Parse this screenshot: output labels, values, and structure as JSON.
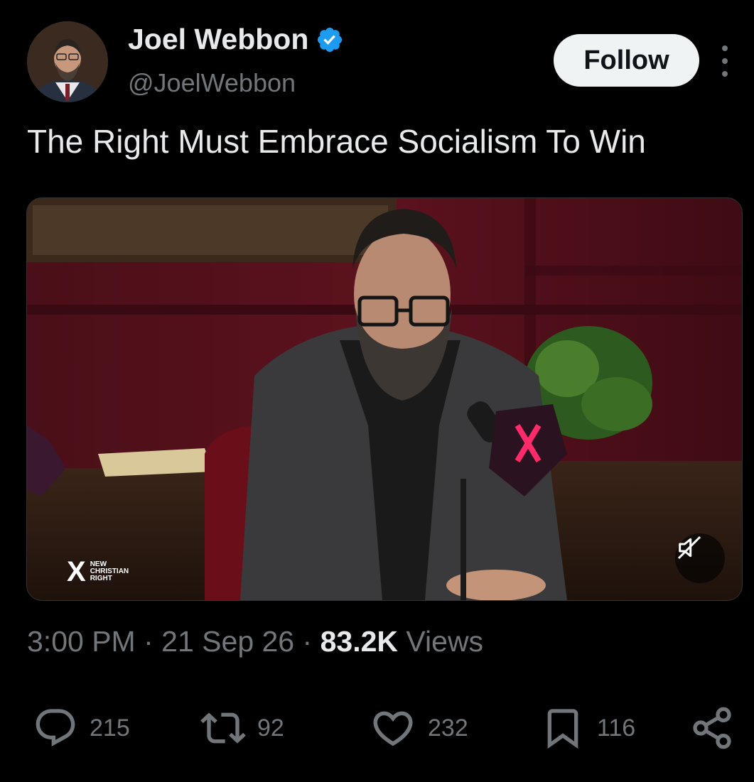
{
  "author": {
    "display_name": "Joel Webbon",
    "handle": "@JoelWebbon",
    "verified": true,
    "avatar_icon": "profile-photo"
  },
  "follow_button": {
    "label": "Follow"
  },
  "tweet": {
    "text": "The Right Must Embrace Socialism To Win"
  },
  "media": {
    "watermark_lines": [
      "NEW",
      "CHRISTIAN",
      "RIGHT"
    ],
    "mute_icon": "speaker-muted-icon"
  },
  "meta": {
    "time": "3:00 PM",
    "separator": "·",
    "date": "21 Sep 26",
    "views_count": "83.2K",
    "views_label": "Views"
  },
  "actions": {
    "replies": "215",
    "reposts": "92",
    "likes": "232",
    "bookmarks": "116"
  },
  "colors": {
    "background": "#000000",
    "text_primary": "#e7e9ea",
    "text_secondary": "#71767b",
    "verified_blue": "#1d9bf0",
    "follow_bg": "#eff3f4"
  }
}
